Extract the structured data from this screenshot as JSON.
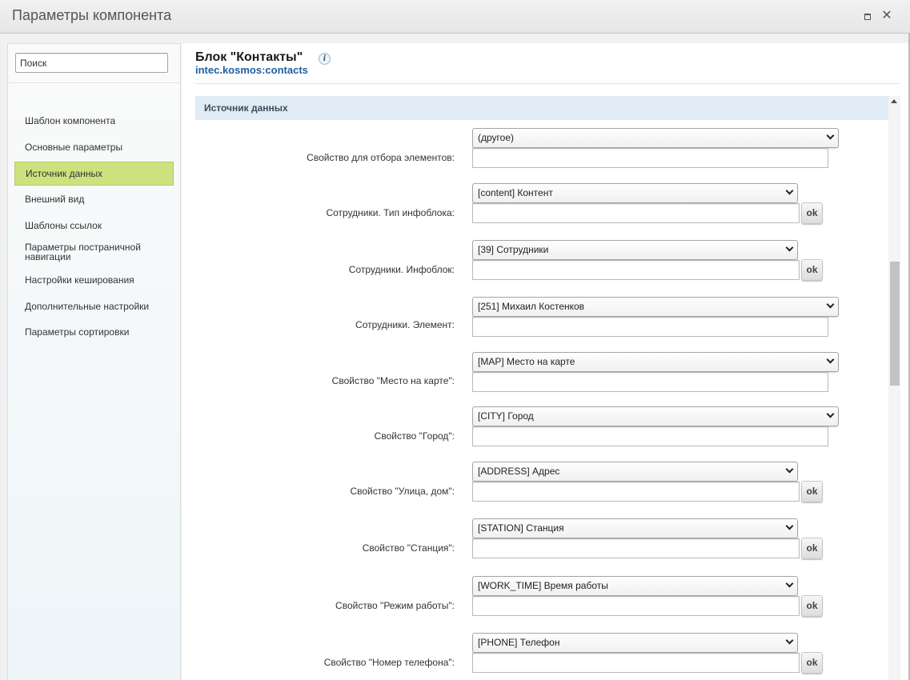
{
  "window": {
    "title": "Параметры компонента"
  },
  "sidebar": {
    "search_placeholder": "Поиск",
    "items": [
      {
        "label": "Шаблон компонента"
      },
      {
        "label": "Основные параметры"
      },
      {
        "label": "Источник данных",
        "active": true
      },
      {
        "label": "Внешний вид"
      },
      {
        "label": "Шаблоны ссылок"
      },
      {
        "label": "Параметры постраничной навигации"
      },
      {
        "label": "Настройки кеширования"
      },
      {
        "label": "Дополнительные настройки"
      },
      {
        "label": "Параметры сортировки"
      }
    ]
  },
  "header": {
    "title": "Блок \"Контакты\"",
    "code": "intec.kosmos:contacts",
    "info_icon": "i"
  },
  "section": {
    "title": "Источник данных"
  },
  "fields": [
    {
      "label": "Свойство для отбора элементов:",
      "value": "(другое)",
      "ok": false
    },
    {
      "label": "Сотрудники. Тип инфоблока:",
      "value": "[content] Контент",
      "ok": true
    },
    {
      "label": "Сотрудники. Инфоблок:",
      "value": "[39] Сотрудники",
      "ok": true
    },
    {
      "label": "Сотрудники. Элемент:",
      "value": "[251] Михаил Костенков",
      "ok": false
    },
    {
      "label": "Свойство \"Место на карте\":",
      "value": "[MAP] Место на карте",
      "ok": false
    },
    {
      "label": "Свойство \"Город\":",
      "value": "[CITY] Город",
      "ok": false
    },
    {
      "label": "Свойство \"Улица, дом\":",
      "value": "[ADDRESS] Адрес",
      "ok": true
    },
    {
      "label": "Свойство \"Станция\":",
      "value": "[STATION] Станция",
      "ok": true
    },
    {
      "label": "Свойство \"Режим работы\":",
      "value": "[WORK_TIME] Время работы",
      "ok": true
    },
    {
      "label": "Свойство \"Номер телефона\":",
      "value": "[PHONE] Телефон",
      "ok": true
    }
  ],
  "ok_label": "ok",
  "icons": {
    "maximize": "maximize-icon",
    "close": "close-icon"
  }
}
